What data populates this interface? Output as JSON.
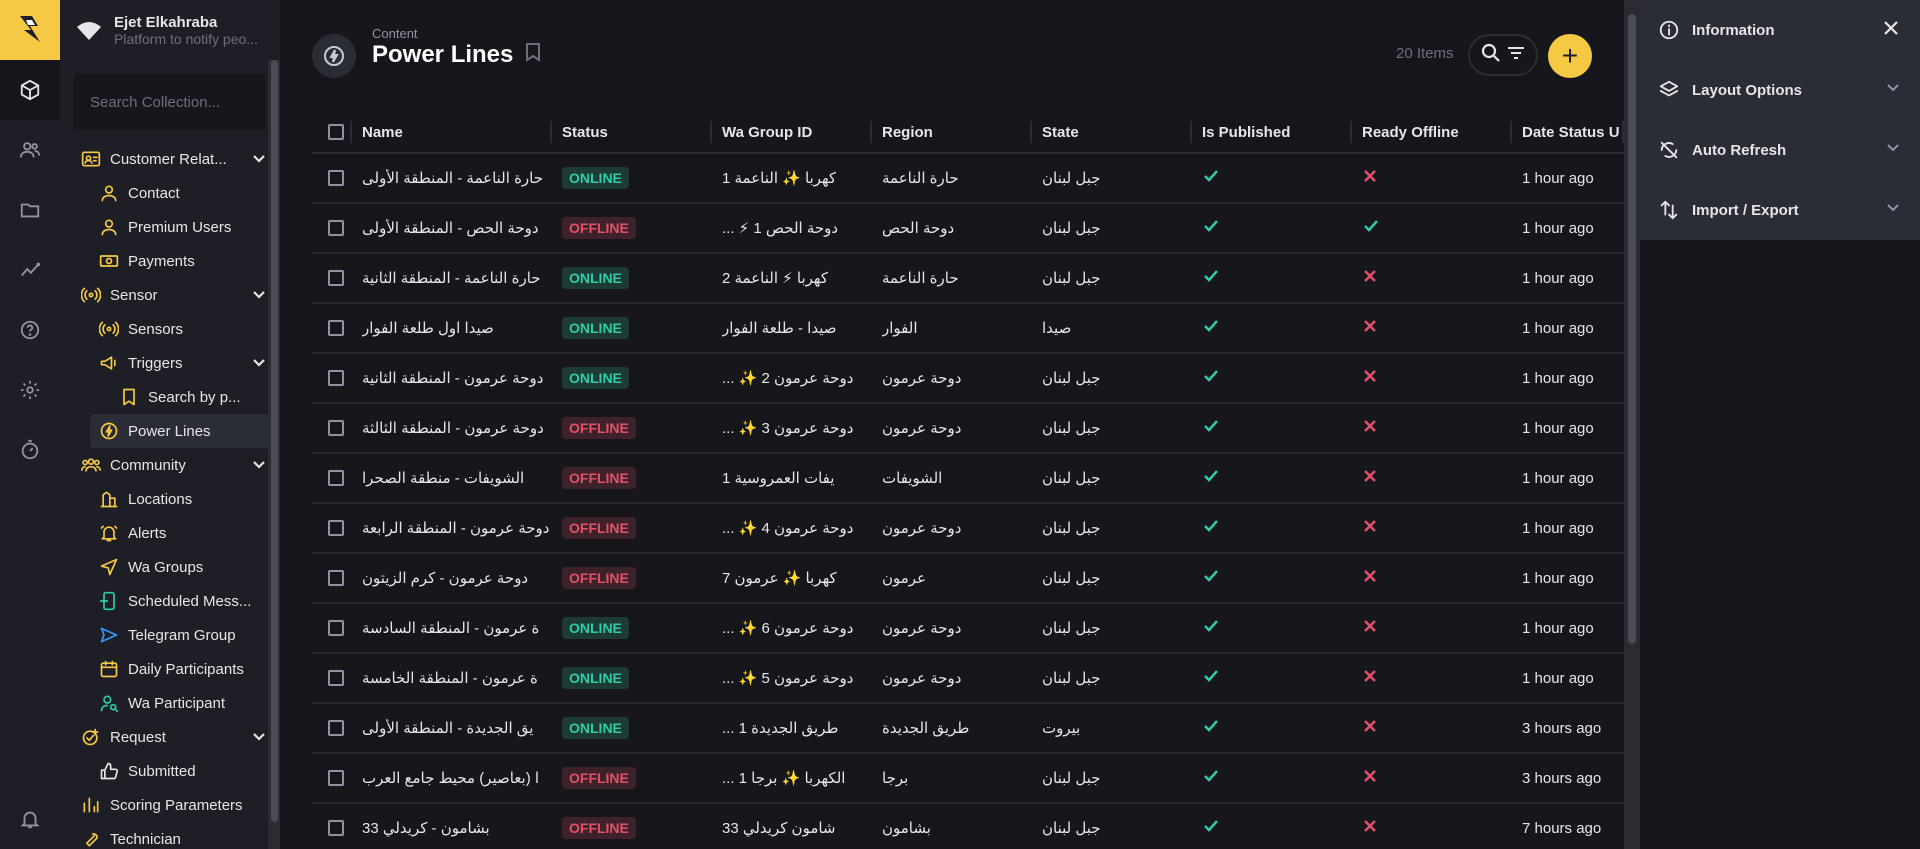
{
  "project": {
    "name": "Ejet Elkahraba",
    "description": "Platform to notify peo..."
  },
  "nav": {
    "search_placeholder": "Search Collection...",
    "items": [
      {
        "label": "Customer Relat...",
        "level": 0,
        "icon": "contact-card-icon",
        "color": "#f6c945",
        "expand": true
      },
      {
        "label": "Contact",
        "level": 1,
        "icon": "person-icon",
        "color": "#f6c945"
      },
      {
        "label": "Premium Users",
        "level": 1,
        "icon": "person-icon",
        "color": "#f6c945"
      },
      {
        "label": "Payments",
        "level": 1,
        "icon": "money-icon",
        "color": "#f6c945"
      },
      {
        "label": "Sensor",
        "level": 0,
        "icon": "sensor-icon",
        "color": "#f6c945",
        "expand": true
      },
      {
        "label": "Sensors",
        "level": 1,
        "icon": "sensor-icon",
        "color": "#f6c945"
      },
      {
        "label": "Triggers",
        "level": 1,
        "icon": "megaphone-icon",
        "color": "#f6c945",
        "expand": true
      },
      {
        "label": "Search by p...",
        "level": 2,
        "icon": "bookmark-icon",
        "color": "#f6c945"
      },
      {
        "label": "Power Lines",
        "level": 1,
        "icon": "bolt-icon",
        "color": "#f6c945",
        "active": true
      },
      {
        "label": "Community",
        "level": 0,
        "icon": "group-icon",
        "color": "#f6c945",
        "expand": true
      },
      {
        "label": "Locations",
        "level": 1,
        "icon": "location-icon",
        "color": "#f6c945"
      },
      {
        "label": "Alerts",
        "level": 1,
        "icon": "bell-icon",
        "color": "#f6c945"
      },
      {
        "label": "Wa Groups",
        "level": 1,
        "icon": "send-icon",
        "color": "#f6c945"
      },
      {
        "label": "Scheduled Mess...",
        "level": 1,
        "icon": "schedule-icon",
        "color": "#2ecda7"
      },
      {
        "label": "Telegram Group",
        "level": 1,
        "icon": "telegram-icon",
        "color": "#3399ff"
      },
      {
        "label": "Daily Participants",
        "level": 1,
        "icon": "calendar-icon",
        "color": "#f6c945"
      },
      {
        "label": "Wa Participant",
        "level": 1,
        "icon": "person-search-icon",
        "color": "#2ecda7"
      },
      {
        "label": "Request",
        "level": 0,
        "icon": "check-circle-icon",
        "color": "#f6c945",
        "expand": true
      },
      {
        "label": "Submitted",
        "level": 1,
        "icon": "thumb-up-icon",
        "color": "#e6e6ea"
      },
      {
        "label": "Scoring Parameters",
        "level": 0,
        "icon": "bar-chart-icon",
        "color": "#f6c945"
      },
      {
        "label": "Technician",
        "level": 0,
        "icon": "wrench-icon",
        "color": "#f6c945"
      }
    ]
  },
  "header": {
    "breadcrumb": "Content",
    "title": "Power Lines",
    "count": "20 Items",
    "add_label": "+"
  },
  "table": {
    "columns": [
      "Name",
      "Status",
      "Wa Group ID",
      "Region",
      "State",
      "Is Published",
      "Ready Offline",
      "Date Status U"
    ],
    "rows": [
      {
        "name": "حارة الناعمة - المنطقة الأولى",
        "status": "ONLINE",
        "wa": "كهربا ✨ الناعمة 1",
        "region": "حارة الناعمة",
        "state": "جبل لبنان",
        "pub": true,
        "off": false,
        "date": "1 hour ago"
      },
      {
        "name": "دوحة الحص - المنطقة الأولى",
        "status": "OFFLINE",
        "wa": "... ⚡ دوحة الحص 1",
        "region": "دوحة الحص",
        "state": "جبل لبنان",
        "pub": true,
        "off": true,
        "date": "1 hour ago"
      },
      {
        "name": "حارة الناعمة - المنطقة الثانية",
        "status": "ONLINE",
        "wa": "كهربا ⚡ الناعمة 2",
        "region": "حارة الناعمة",
        "state": "جبل لبنان",
        "pub": true,
        "off": false,
        "date": "1 hour ago"
      },
      {
        "name": "صيدا اول طلعة الفوار",
        "status": "ONLINE",
        "wa": "صيدا - طلعة الفوار",
        "region": "الفوار",
        "state": "صيدا",
        "pub": true,
        "off": false,
        "date": "1 hour ago"
      },
      {
        "name": "دوحة عرمون - المنطقة الثانية",
        "status": "ONLINE",
        "wa": "... ✨ دوحة عرمون 2",
        "region": "دوحة عرمون",
        "state": "جبل لبنان",
        "pub": true,
        "off": false,
        "date": "1 hour ago"
      },
      {
        "name": "دوحة عرمون - المنطقة الثالثة",
        "status": "OFFLINE",
        "wa": "... ✨ دوحة عرمون 3",
        "region": "دوحة عرمون",
        "state": "جبل لبنان",
        "pub": true,
        "off": false,
        "date": "1 hour ago"
      },
      {
        "name": "الشويفات - منطقة الصحرا",
        "status": "OFFLINE",
        "wa": "يفات العمروسية 1",
        "region": "الشويفات",
        "state": "جبل لبنان",
        "pub": true,
        "off": false,
        "date": "1 hour ago"
      },
      {
        "name": "دوحة عرمون - المنطقة الرابعة",
        "status": "OFFLINE",
        "wa": "... ✨ دوحة عرمون 4",
        "region": "دوحة عرمون",
        "state": "جبل لبنان",
        "pub": true,
        "off": false,
        "date": "1 hour ago"
      },
      {
        "name": "دوحة عرمون - كرم الزيتون",
        "status": "OFFLINE",
        "wa": "كهربا ✨ عرمون 7",
        "region": "عرمون",
        "state": "جبل لبنان",
        "pub": true,
        "off": false,
        "date": "1 hour ago"
      },
      {
        "name": "ة عرمون - المنطقة السادسة",
        "status": "ONLINE",
        "wa": "... ✨ دوحة عرمون 6",
        "region": "دوحة عرمون",
        "state": "جبل لبنان",
        "pub": true,
        "off": false,
        "date": "1 hour ago"
      },
      {
        "name": "ة عرمون - المنطقة الخامسة",
        "status": "ONLINE",
        "wa": "... ✨ دوحة عرمون 5",
        "region": "دوحة عرمون",
        "state": "جبل لبنان",
        "pub": true,
        "off": false,
        "date": "1 hour ago"
      },
      {
        "name": "يق الجديدة - المنطقة الأولى",
        "status": "ONLINE",
        "wa": "... طريق الجديدة 1",
        "region": "طريق الجديدة",
        "state": "بيروت",
        "pub": true,
        "off": false,
        "date": "3 hours ago"
      },
      {
        "name": "ا (بعاصير) محيط جامع العرب",
        "status": "OFFLINE",
        "wa": "... الكهربا ✨ برجا 1",
        "region": "برجا",
        "state": "جبل لبنان",
        "pub": true,
        "off": false,
        "date": "3 hours ago"
      },
      {
        "name": "بشامون - كريدلي 33",
        "status": "OFFLINE",
        "wa": "شامون كريدلي 33",
        "region": "بشامون",
        "state": "جبل لبنان",
        "pub": true,
        "off": false,
        "date": "7 hours ago"
      }
    ]
  },
  "sidebar": {
    "items": [
      {
        "label": "Information",
        "icon": "info-icon",
        "action": "close"
      },
      {
        "label": "Layout Options",
        "icon": "layers-icon",
        "action": "expand"
      },
      {
        "label": "Auto Refresh",
        "icon": "sync-off-icon",
        "action": "expand"
      },
      {
        "label": "Import / Export",
        "icon": "import-export-icon",
        "action": "expand"
      }
    ]
  }
}
